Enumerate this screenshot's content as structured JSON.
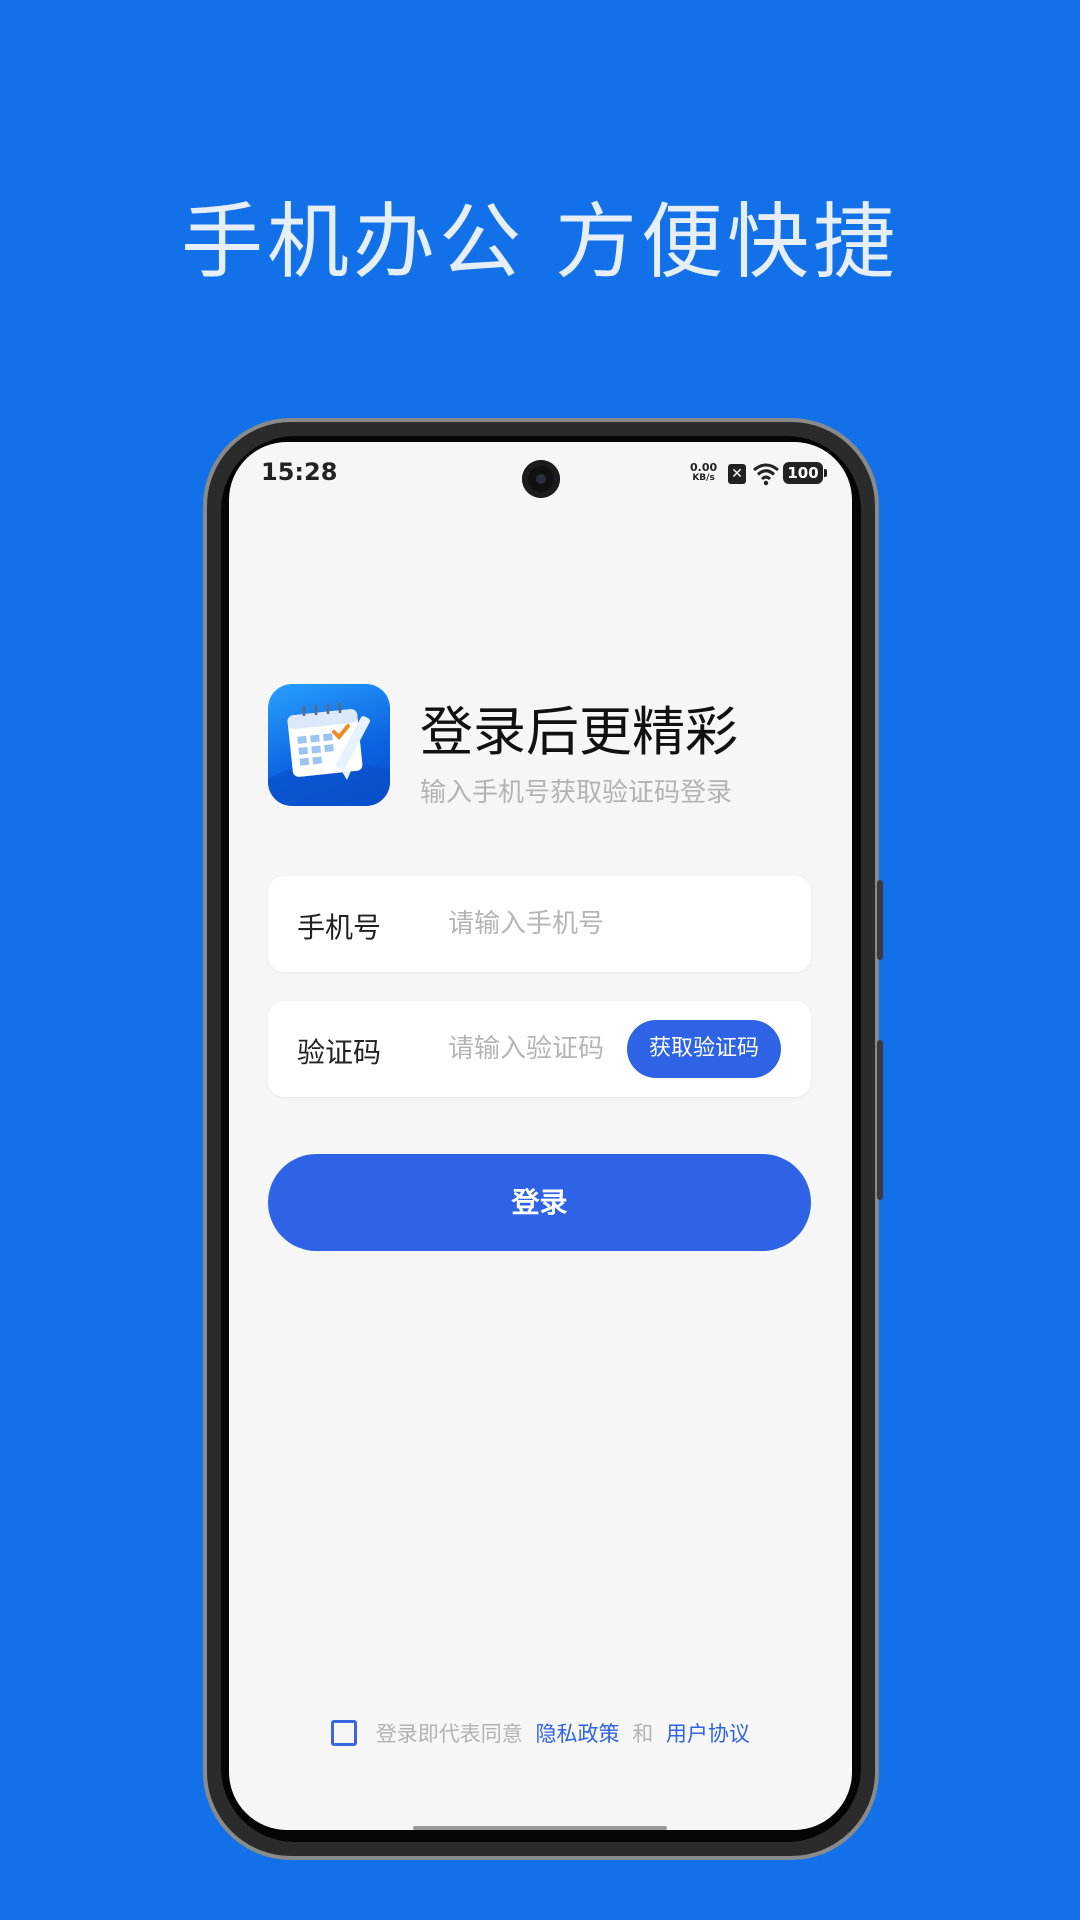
{
  "headline": "手机办公 方便快捷",
  "status_bar": {
    "time": "15:28",
    "net_speed_value": "0.00",
    "net_speed_unit": "KB/s",
    "battery": "100"
  },
  "login": {
    "title": "登录后更精彩",
    "subtitle": "输入手机号获取验证码登录",
    "phone_label": "手机号",
    "phone_placeholder": "请输入手机号",
    "code_label": "验证码",
    "code_placeholder": "请输入验证码",
    "get_code_button": "获取验证码",
    "login_button": "登录"
  },
  "agreement": {
    "checked": false,
    "prefix": "登录即代表同意",
    "privacy_link": "隐私政策",
    "conjunction": "和",
    "terms_link": "用户协议"
  },
  "colors": {
    "background": "#1271e8",
    "accent": "#2f63e6"
  }
}
